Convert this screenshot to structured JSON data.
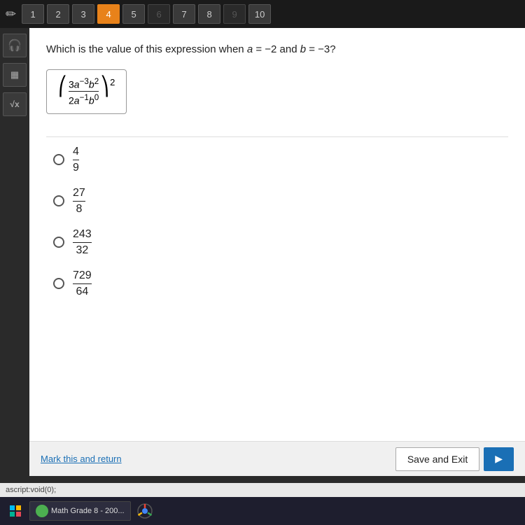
{
  "toolbar": {
    "questions": [
      {
        "num": "1",
        "state": "normal"
      },
      {
        "num": "2",
        "state": "normal"
      },
      {
        "num": "3",
        "state": "normal"
      },
      {
        "num": "4",
        "state": "active"
      },
      {
        "num": "5",
        "state": "normal"
      },
      {
        "num": "6",
        "state": "disabled"
      },
      {
        "num": "7",
        "state": "normal"
      },
      {
        "num": "8",
        "state": "normal"
      },
      {
        "num": "9",
        "state": "disabled"
      },
      {
        "num": "10",
        "state": "normal"
      }
    ]
  },
  "sidebar": {
    "icons": [
      {
        "name": "headphones-icon",
        "symbol": "🎧"
      },
      {
        "name": "calculator-icon",
        "symbol": "🖩"
      },
      {
        "name": "formula-icon",
        "symbol": "√x"
      }
    ]
  },
  "question": {
    "text": "Which is the value of this expression when ",
    "italic_a": "a",
    "eq_a": "=−2 and ",
    "italic_b": "b",
    "eq_b": "=−3?",
    "expression_label": "(3a⁻³b²/2a⁻¹b⁰)²"
  },
  "answers": [
    {
      "id": "A",
      "num": "4",
      "den": "9"
    },
    {
      "id": "B",
      "num": "27",
      "den": "8"
    },
    {
      "id": "C",
      "num": "243",
      "den": "32"
    },
    {
      "id": "D",
      "num": "729",
      "den": "64"
    }
  ],
  "bottom": {
    "mark_return": "Mark this and return",
    "save_exit": "Save and Exit",
    "next_arrow": "▶"
  },
  "status_bar": {
    "text": "ascript:void(0);"
  },
  "taskbar": {
    "app_label": "Math Grade 8 - 200...",
    "start_icon": "⊞"
  }
}
